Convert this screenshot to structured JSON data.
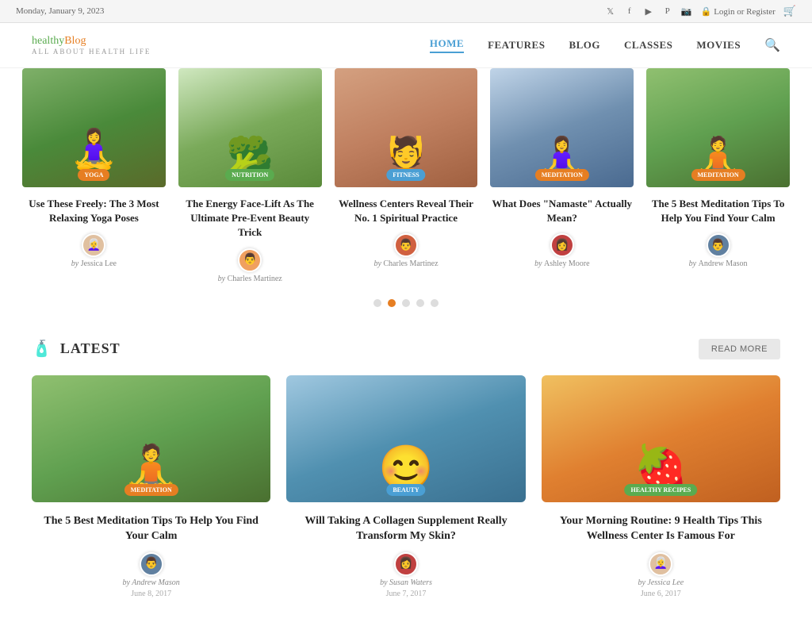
{
  "topbar": {
    "date": "Monday, January 9, 2023",
    "auth": {
      "login": "Login",
      "or": "or",
      "register": "Register"
    },
    "social": [
      "twitter",
      "facebook",
      "youtube",
      "pinterest",
      "instagram"
    ]
  },
  "header": {
    "logo": {
      "healthy": "healthy",
      "blog": "Blog",
      "tagline": "ALL ABOUT HEALTH LIFE"
    },
    "nav": [
      {
        "label": "HOME",
        "active": true
      },
      {
        "label": "FEATURES",
        "active": false
      },
      {
        "label": "BLOG",
        "active": false
      },
      {
        "label": "CLASSES",
        "active": false
      },
      {
        "label": "MOVIES",
        "active": false
      }
    ]
  },
  "carousel": {
    "articles": [
      {
        "category": "YOGA",
        "category_type": "yoga",
        "title": "Use These Freely: The 3 Most Relaxing Yoga Poses",
        "author": "Jessica Lee",
        "image_type": "yoga",
        "avatar_emoji": "👩‍🦳"
      },
      {
        "category": "NUTRITION",
        "category_type": "nutrition",
        "title": "The Energy Face-Lift As The Ultimate Pre-Event Beauty Trick",
        "author": "Charles Martinez",
        "image_type": "nutrition",
        "avatar_emoji": "👨"
      },
      {
        "category": "FITNESS",
        "category_type": "fitness",
        "title": "Wellness Centers Reveal Their No. 1 Spiritual Practice",
        "author": "Charles Martinez",
        "image_type": "fitness",
        "avatar_emoji": "👨"
      },
      {
        "category": "MEDITATION",
        "category_type": "meditation",
        "title": "What Does \"Namaste\" Actually Mean?",
        "author": "Ashley Moore",
        "image_type": "meditation1",
        "avatar_emoji": "👩"
      },
      {
        "category": "MEDITATION",
        "category_type": "meditation",
        "title": "The 5 Best Meditation Tips To Help You Find Your Calm",
        "author": "Andrew Mason",
        "image_type": "meditation2",
        "avatar_emoji": "👨"
      }
    ],
    "dots": [
      1,
      2,
      3,
      4,
      5
    ],
    "active_dot": 2
  },
  "latest": {
    "section_title": "LATEST",
    "read_more_label": "READ MORE",
    "articles": [
      {
        "category": "MEDITATION",
        "category_type": "meditation",
        "title": "The 5 Best Meditation Tips To Help You Find Your Calm",
        "author": "Andrew Mason",
        "date": "June 8, 2017",
        "image_type": "med",
        "avatar_emoji": "👨",
        "by": "by"
      },
      {
        "category": "BEAUTY",
        "category_type": "fitness",
        "title": "Will Taking A Collagen Supplement Really Transform My Skin?",
        "author": "Susan Waters",
        "date": "June 7, 2017",
        "image_type": "beauty",
        "avatar_emoji": "👩",
        "by": "by"
      },
      {
        "category": "HEALTHY RECIPES",
        "category_type": "nutrition",
        "title": "Your Morning Routine: 9 Health Tips This Wellness Center Is Famous For",
        "author": "Jessica Lee",
        "date": "June 6, 2017",
        "image_type": "recipes",
        "avatar_emoji": "👩",
        "by": "by"
      }
    ]
  }
}
